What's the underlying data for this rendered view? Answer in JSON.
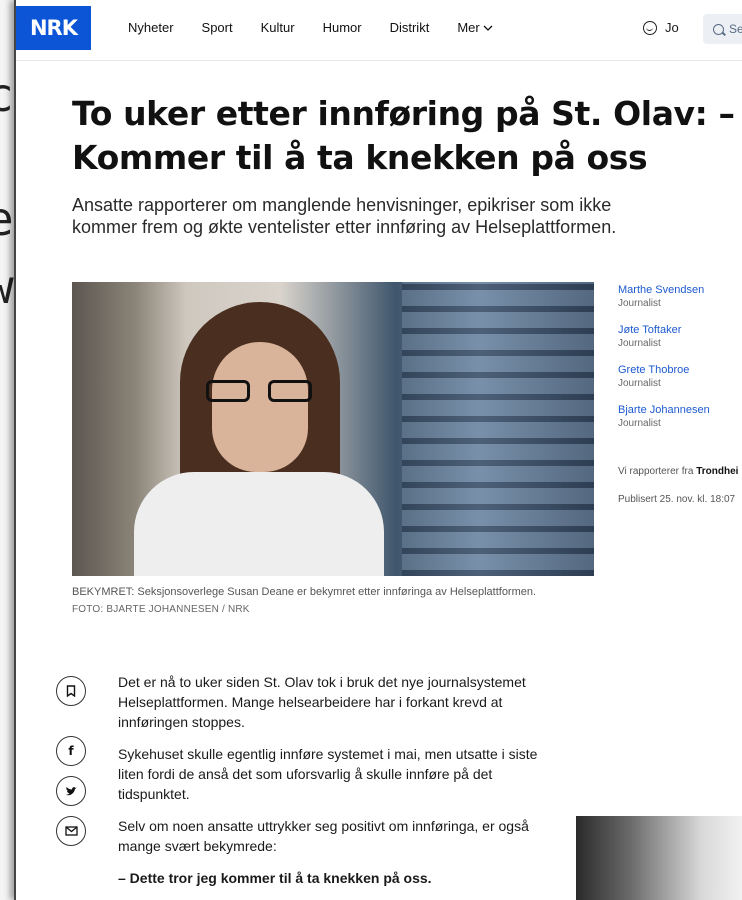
{
  "background_letters": [
    "c",
    "e",
    "w"
  ],
  "brand": {
    "logo": "NRK",
    "color": "#0b55d6"
  },
  "nav": {
    "items": [
      "Nyheter",
      "Sport",
      "Kultur",
      "Humor",
      "Distrikt"
    ],
    "more_label": "Mer"
  },
  "user": {
    "name": "Jo",
    "icon": "smiley-icon"
  },
  "search": {
    "placeholder": "Se",
    "icon": "search-icon"
  },
  "article": {
    "title": "To uker etter innføring på St. Olav: – Kommer til å ta knekken på oss",
    "lead": "Ansatte rapporterer om manglende henvisninger, epikriser som ikke kommer frem og økte ventelister etter innføring av Helseplattformen.",
    "caption": "BEKYMRET: Seksjonsoverlege Susan Deane er bekymret etter innføringa av Helseplattformen.",
    "photo_credit": "FOTO: BJARTE JOHANNESEN / NRK",
    "authors": [
      {
        "name": "Marthe Svendsen",
        "role": "Journalist"
      },
      {
        "name": "Jøte Toftaker",
        "role": "Journalist"
      },
      {
        "name": "Grete Thobroe",
        "role": "Journalist"
      },
      {
        "name": "Bjarte Johannesen",
        "role": "Journalist"
      }
    ],
    "reporting_from_prefix": "Vi rapporterer fra",
    "reporting_from_place": "Trondhei",
    "published": "Publisert 25. nov. kl. 18:07",
    "paragraphs": [
      "Det er nå to uker siden St. Olav tok i bruk det nye journalsystemet Helseplattformen. Mange helsearbeidere har i forkant krevd at innføringen stoppes.",
      "Sykehuset skulle egentlig innføre systemet i mai, men utsatte i siste liten fordi de anså det som uforsvarlig å skulle innføre på det tidspunktet.",
      "Selv om noen ansatte uttrykker seg positivt om innføringa, er også mange svært bekymrede:"
    ],
    "quote": "– Dette tror jeg kommer til å ta knekken på oss."
  },
  "share_buttons": [
    "bookmark-icon",
    "facebook-icon",
    "twitter-icon",
    "email-icon"
  ]
}
